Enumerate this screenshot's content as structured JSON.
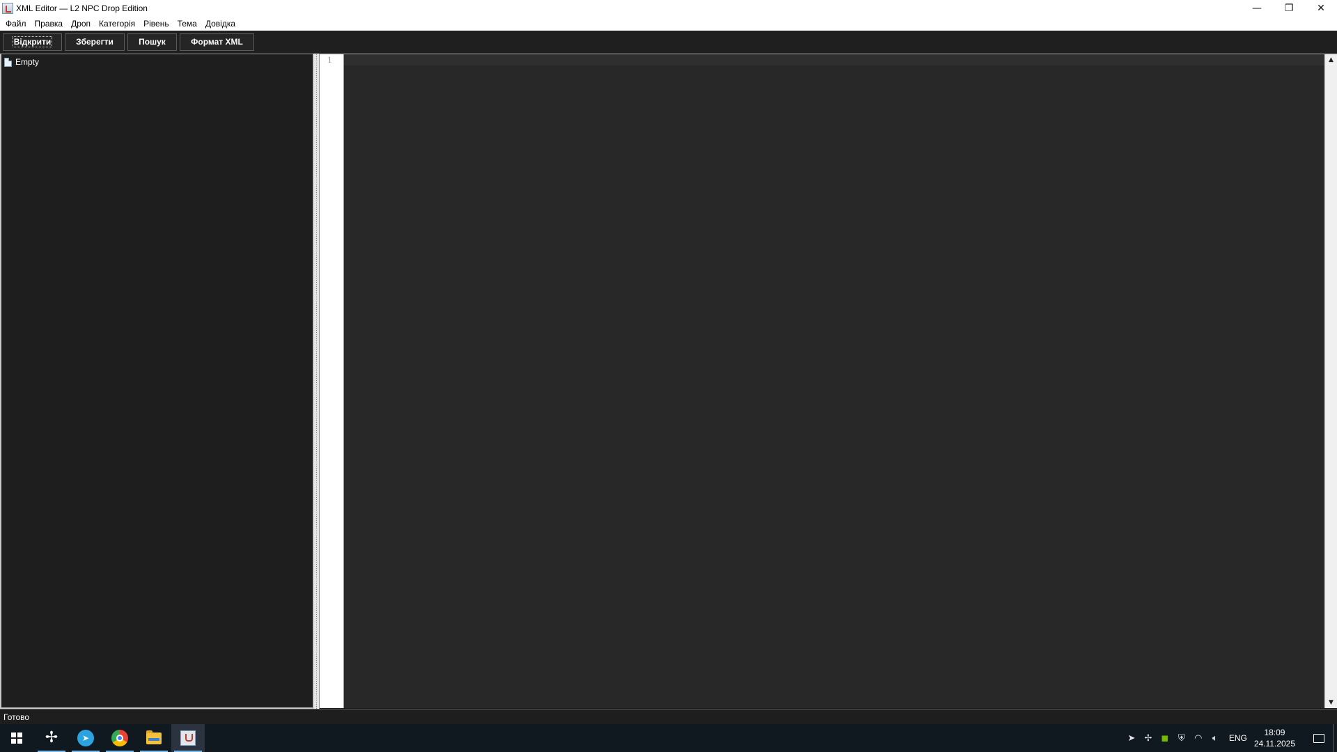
{
  "window": {
    "title": "XML Editor — L2 NPC Drop Edition",
    "controls": {
      "minimize": "—",
      "maximize": "❐",
      "close": "✕"
    }
  },
  "menubar": {
    "items": [
      "Файл",
      "Правка",
      "Дроп",
      "Категорія",
      "Рівень",
      "Тема",
      "Довідка"
    ]
  },
  "toolbar": {
    "buttons": [
      "Відкрити",
      "Зберегти",
      "Пошук",
      "Формат XML"
    ]
  },
  "tree": {
    "root_label": "Empty",
    "icon": "file-icon"
  },
  "editor": {
    "line_numbers": [
      "1"
    ]
  },
  "status": {
    "text": "Готово"
  },
  "taskbar": {
    "apps": [
      "start",
      "fan-app",
      "telegram",
      "chrome",
      "file-explorer",
      "java-app"
    ],
    "tray": {
      "icons": [
        "telegram-tray-icon",
        "fan-tray-icon",
        "nvidia-icon",
        "security-icon",
        "network-icon",
        "volume-icon"
      ],
      "language": "ENG",
      "time": "18:09",
      "date": "24.11.2025"
    }
  },
  "colors": {
    "toolbar_bg": "#1f1f1f",
    "editor_bg": "#282828",
    "tree_bg": "#1e1e1e",
    "taskbar_bg": "#101820",
    "taskbar_accent": "#76b9ed"
  }
}
